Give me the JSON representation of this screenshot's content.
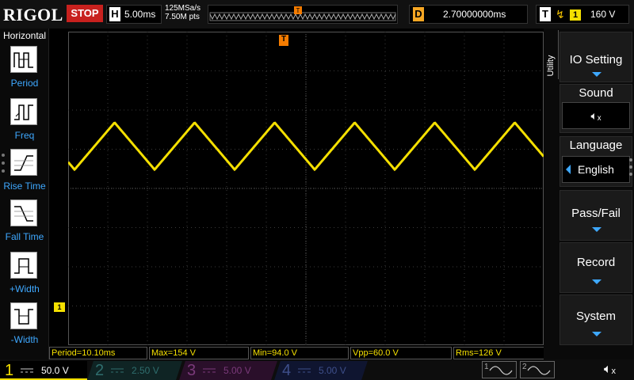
{
  "topbar": {
    "brand": "RIGOL",
    "run_state": "STOP",
    "timebase_letter": "H",
    "timebase_value": "5.00ms",
    "sample_rate": "125MSa/s",
    "memory_depth": "7.50M pts",
    "waveform_trigger_label": "T",
    "delay_letter": "D",
    "delay_value": "2.70000000ms",
    "trigger_letter": "T",
    "trigger_edge_icon": "rising-edge-icon",
    "trigger_channel": "1",
    "trigger_level": "160 V"
  },
  "left_panel": {
    "title": "Horizontal",
    "items": [
      {
        "label": "Period",
        "icon": "period-icon"
      },
      {
        "label": "Freq",
        "icon": "freq-icon"
      },
      {
        "label": "Rise Time",
        "icon": "rise-time-icon"
      },
      {
        "label": "Fall Time",
        "icon": "fall-time-icon"
      },
      {
        "label": "+Width",
        "icon": "positive-width-icon"
      },
      {
        "label": "-Width",
        "icon": "negative-width-icon"
      }
    ]
  },
  "screen": {
    "trigger_marker": "T",
    "channel_marker": "1",
    "grid_color": "#3a3a3a",
    "trace_color": "#f5e000"
  },
  "measurements": [
    {
      "text": "Period=10.10ms"
    },
    {
      "text": "Max=154 V"
    },
    {
      "text": "Min=94.0 V"
    },
    {
      "text": "Vpp=60.0 V"
    },
    {
      "text": "Rms=126 V"
    }
  ],
  "right_panel": {
    "section": "Utility",
    "menus": [
      {
        "label": "IO Setting"
      },
      {
        "label": "Sound",
        "value_icon": "speaker-muted-icon"
      },
      {
        "label": "Language",
        "value": "English"
      },
      {
        "label": "Pass/Fail"
      },
      {
        "label": "Record"
      },
      {
        "label": "System"
      }
    ]
  },
  "bottombar": {
    "channels": [
      {
        "num": "1",
        "scale": "50.0 V",
        "color": "#f5e000"
      },
      {
        "num": "2",
        "scale": "2.50 V",
        "color": "#2f6e6e"
      },
      {
        "num": "3",
        "scale": "5.00 V",
        "color": "#7a3a7a"
      },
      {
        "num": "4",
        "scale": "5.00 V",
        "color": "#3e4f8a"
      }
    ],
    "generators": [
      {
        "num": "1",
        "icon": "sine-wave-icon"
      },
      {
        "num": "2",
        "icon": "sine-wave-icon"
      }
    ],
    "speaker_icon": "speaker-muted-icon"
  },
  "chart_data": {
    "type": "line",
    "title": "",
    "xlabel": "",
    "ylabel": "",
    "waveform": "triangle",
    "period_ms": 10.1,
    "max_v": 154,
    "min_v": 94.0,
    "vpp_v": 60.0,
    "rms_v": 126,
    "volts_per_div": 50.0,
    "ms_per_div": 5.0,
    "horizontal_divisions": 12,
    "vertical_divisions": 8,
    "ch1_offset_v": -70,
    "grid": true
  }
}
